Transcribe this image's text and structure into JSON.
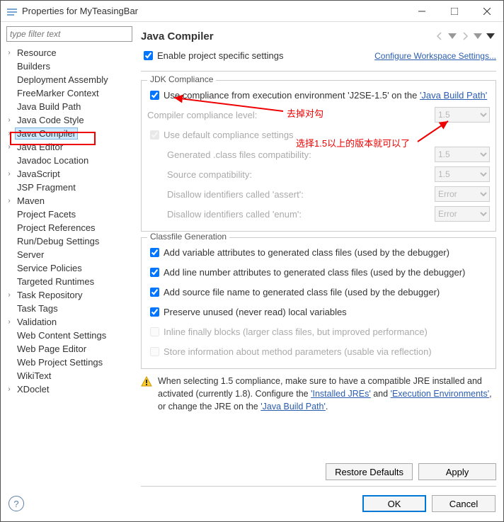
{
  "window": {
    "title": "Properties for MyTeasingBar"
  },
  "sidebar": {
    "filter_placeholder": "type filter text",
    "items": [
      {
        "label": "Resource",
        "expandable": true
      },
      {
        "label": "Builders",
        "expandable": false
      },
      {
        "label": "Deployment Assembly",
        "expandable": false
      },
      {
        "label": "FreeMarker Context",
        "expandable": false
      },
      {
        "label": "Java Build Path",
        "expandable": false
      },
      {
        "label": "Java Code Style",
        "expandable": true
      },
      {
        "label": "Java Compiler",
        "expandable": true,
        "selected": true
      },
      {
        "label": "Java Editor",
        "expandable": true
      },
      {
        "label": "Javadoc Location",
        "expandable": false
      },
      {
        "label": "JavaScript",
        "expandable": true
      },
      {
        "label": "JSP Fragment",
        "expandable": false
      },
      {
        "label": "Maven",
        "expandable": true
      },
      {
        "label": "Project Facets",
        "expandable": false
      },
      {
        "label": "Project References",
        "expandable": false
      },
      {
        "label": "Run/Debug Settings",
        "expandable": false
      },
      {
        "label": "Server",
        "expandable": false
      },
      {
        "label": "Service Policies",
        "expandable": false
      },
      {
        "label": "Targeted Runtimes",
        "expandable": false
      },
      {
        "label": "Task Repository",
        "expandable": true
      },
      {
        "label": "Task Tags",
        "expandable": false
      },
      {
        "label": "Validation",
        "expandable": true
      },
      {
        "label": "Web Content Settings",
        "expandable": false
      },
      {
        "label": "Web Page Editor",
        "expandable": false
      },
      {
        "label": "Web Project Settings",
        "expandable": false
      },
      {
        "label": "WikiText",
        "expandable": false
      },
      {
        "label": "XDoclet",
        "expandable": true
      }
    ]
  },
  "main": {
    "title": "Java Compiler",
    "enable_project_specific": "Enable project specific settings",
    "configure_link": "Configure Workspace Settings...",
    "jdk": {
      "title": "JDK Compliance",
      "use_compliance_prefix": "Use compliance from execution environment 'J2SE-1.5' on the ",
      "use_compliance_link": "'Java Build Path'",
      "compiler_level_label": "Compiler compliance level:",
      "compiler_level_value": "1.5",
      "use_default": "Use default compliance settings",
      "gen_class_label": "Generated .class files compatibility:",
      "gen_class_value": "1.5",
      "source_compat_label": "Source compatibility:",
      "source_compat_value": "1.5",
      "disallow_assert_label": "Disallow identifiers called 'assert':",
      "disallow_assert_value": "Error",
      "disallow_enum_label": "Disallow identifiers called 'enum':",
      "disallow_enum_value": "Error"
    },
    "classfile": {
      "title": "Classfile Generation",
      "var_attr": "Add variable attributes to generated class files (used by the debugger)",
      "line_num": "Add line number attributes to generated class files (used by the debugger)",
      "src_name": "Add source file name to generated class file (used by the debugger)",
      "preserve": "Preserve unused (never read) local variables",
      "inline": "Inline finally blocks (larger class files, but improved performance)",
      "store_param": "Store information about method parameters (usable via reflection)"
    },
    "warn": {
      "text1": "When selecting 1.5 compliance, make sure to have a compatible JRE installed and activated (currently 1.8). Configure the ",
      "link1": "'Installed JREs'",
      "and": " and ",
      "link2": "'Execution Environments'",
      "text2": ", or change the JRE on the ",
      "link3": "'Java Build Path'",
      "dot": "."
    },
    "restore_defaults": "Restore Defaults",
    "apply": "Apply"
  },
  "footer": {
    "ok": "OK",
    "cancel": "Cancel"
  },
  "annotations": {
    "uncheck": "去掉对勾",
    "select15": "选择1.5以上的版本就可以了"
  }
}
